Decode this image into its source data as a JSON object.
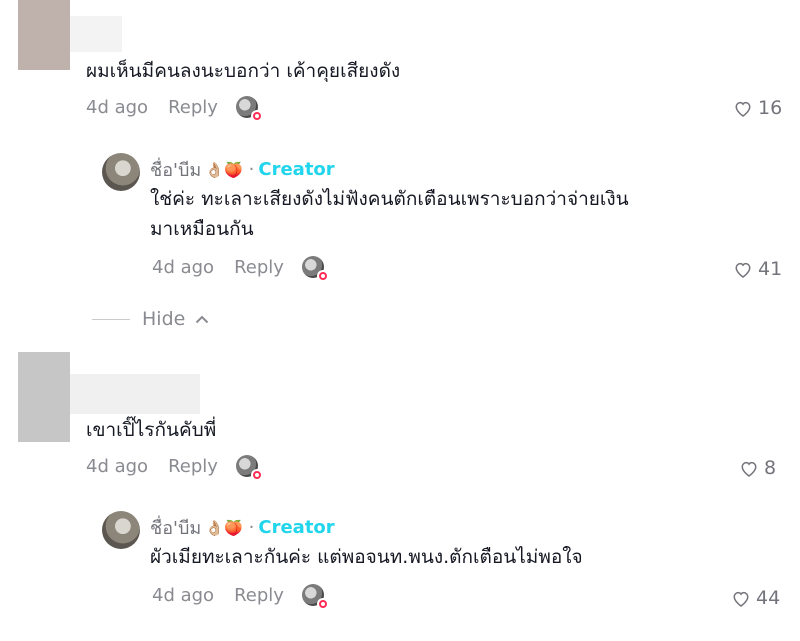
{
  "comments": [
    {
      "text": "ผมเห็นมีคนลงนะบอกว่า เค้าคุยเสียงดัง",
      "time": "4d ago",
      "reply_label": "Reply",
      "likes": "16",
      "reply": {
        "username": "ชื่อ'บีม",
        "emoji": "👌🏼🍑",
        "separator": "·",
        "badge": "Creator",
        "text_lines": [
          "ใช่ค่ะ ทะเลาะเสียงดังไม่ฟังคนตักเตือนเพราะบอกว่าจ่ายเงิน",
          "มาเหมือนกัน"
        ],
        "time": "4d ago",
        "reply_label": "Reply",
        "likes": "41"
      },
      "hide_label": "Hide"
    },
    {
      "text": "เขาเปิ๊ไรกันคับพี่",
      "time": "4d ago",
      "reply_label": "Reply",
      "likes": "8",
      "reply": {
        "username": "ชื่อ'บีม",
        "emoji": "👌🏼🍑",
        "separator": "·",
        "badge": "Creator",
        "text_lines": [
          "ผัวเมียทะเลาะกันค่ะ แต่พอจนท.พนง.ตักเตือนไม่พอใจ"
        ],
        "time": "4d ago",
        "reply_label": "Reply",
        "likes": "44"
      }
    }
  ],
  "colors": {
    "creator_badge": "#20d5ec",
    "muted": "#8a8b91",
    "text": "#161823",
    "notification_dot": "#fe2c55"
  },
  "icons": {
    "like": "heart-outline-icon",
    "hide": "chevron-up-icon"
  }
}
